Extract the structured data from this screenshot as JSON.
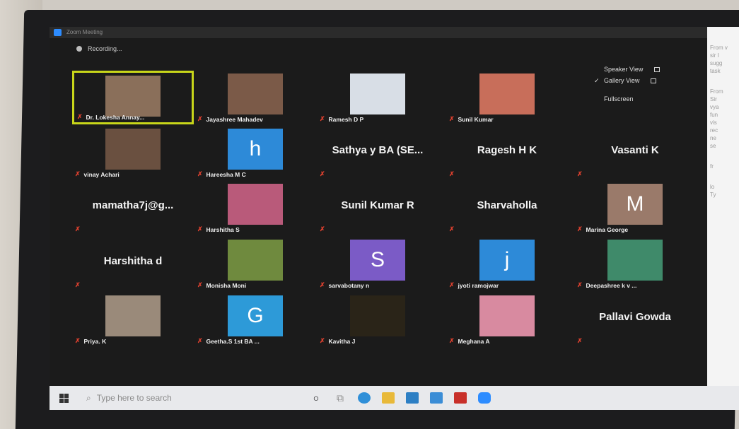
{
  "window": {
    "title": "Zoom Meeting"
  },
  "status": {
    "recording": "Recording..."
  },
  "view_menu": {
    "speaker_view": "Speaker View",
    "gallery_view": "Gallery View",
    "fullscreen": "Fullscreen"
  },
  "participants": [
    {
      "name": "Dr. Lokesha Annay...",
      "kind": "photo",
      "color": "#8a6f5a",
      "active": true
    },
    {
      "name": "Jayashree Mahadev",
      "kind": "photo",
      "color": "#7b5a48"
    },
    {
      "name": "Ramesh D P",
      "kind": "photo",
      "color": "#d8dee6"
    },
    {
      "name": "Sunil Kumar",
      "kind": "photo",
      "color": "#c86e5a"
    },
    {
      "name": "",
      "kind": "blank"
    },
    {
      "name": "vinay Achari",
      "kind": "photo",
      "color": "#6a5040"
    },
    {
      "name": "Hareesha M C",
      "kind": "avatar",
      "letter": "h",
      "color": "#2d8ad8"
    },
    {
      "name": "Sathya y BA (SE...",
      "kind": "text"
    },
    {
      "name": "Ragesh H K",
      "kind": "text"
    },
    {
      "name": "Vasanti K",
      "kind": "text"
    },
    {
      "name": "mamatha7j@g...",
      "kind": "text"
    },
    {
      "name": "Harshitha S",
      "kind": "photo",
      "color": "#b95a7a"
    },
    {
      "name": "Sunil Kumar R",
      "kind": "text"
    },
    {
      "name": "Sharvaholla",
      "kind": "text"
    },
    {
      "name": "Marina George",
      "kind": "avatar",
      "letter": "M",
      "color": "#9a7a6a"
    },
    {
      "name": "Harshitha d",
      "kind": "text"
    },
    {
      "name": "Monisha Moni",
      "kind": "photo",
      "color": "#6f8a3e"
    },
    {
      "name": "sarvabotany n",
      "kind": "avatar",
      "letter": "S",
      "color": "#7b5bc6"
    },
    {
      "name": "jyoti ramojwar",
      "kind": "avatar",
      "letter": "j",
      "color": "#2d8ad8"
    },
    {
      "name": "Deepashree k v ...",
      "kind": "photo",
      "color": "#3f8a6a"
    },
    {
      "name": "Priya. K",
      "kind": "photo",
      "color": "#9a8a7a"
    },
    {
      "name": "Geetha.S 1st BA ...",
      "kind": "avatar",
      "letter": "G",
      "color": "#2d9ad8"
    },
    {
      "name": "Kavitha J",
      "kind": "photo",
      "color": "#2a2418"
    },
    {
      "name": "Meghana A",
      "kind": "photo",
      "color": "#d88aa0"
    },
    {
      "name": "Pallavi Gowda",
      "kind": "text"
    }
  ],
  "chat_panel": {
    "lines": [
      "From v",
      "sir I",
      "sugg",
      "task",
      "From",
      "Sir",
      "vya",
      "fun",
      "vis",
      "rec",
      "ne",
      "se",
      "fr",
      "lo",
      "Ty"
    ]
  },
  "taskbar": {
    "search_placeholder": "Type here to search",
    "apps": [
      "cortana",
      "task-view",
      "edge",
      "file-explorer",
      "mail",
      "store",
      "mcafee",
      "zoom"
    ]
  }
}
